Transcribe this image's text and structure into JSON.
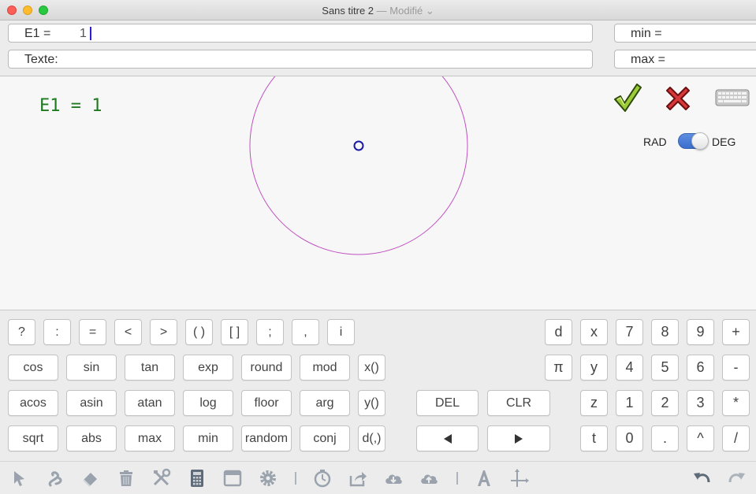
{
  "window": {
    "title": "Sans titre 2",
    "title_separator": " — ",
    "title_status": "Modifié"
  },
  "form": {
    "e1_label": "E1 =",
    "e1_value": "1",
    "texte_label": "Texte:",
    "min_label": "min =",
    "max_label": "max ="
  },
  "canvas": {
    "expression": "E1 = 1",
    "rad_label": "RAD",
    "deg_label": "DEG",
    "angle_mode": "DEG",
    "colors": {
      "circle": "#c050c0",
      "point": "#1a1aa8",
      "expression": "#1f7a1f"
    }
  },
  "keypad": {
    "row1_symbols": [
      "?",
      ":",
      "=",
      "<",
      ">",
      "( )",
      "[ ]",
      ";",
      ",",
      "i"
    ],
    "functions_row2": [
      "cos",
      "sin",
      "tan",
      "exp",
      "round",
      "mod",
      "x()"
    ],
    "functions_row3": [
      "acos",
      "asin",
      "atan",
      "log",
      "floor",
      "arg",
      "y()"
    ],
    "functions_row4": [
      "sqrt",
      "abs",
      "max",
      "min",
      "random",
      "conj",
      "d(,)"
    ],
    "del_label": "DEL",
    "clr_label": "CLR",
    "num_row1": [
      "d",
      "x",
      "7",
      "8",
      "9",
      "+"
    ],
    "num_row2": [
      "π",
      "y",
      "4",
      "5",
      "6",
      "-"
    ],
    "num_row3": [
      "z",
      "1",
      "2",
      "3",
      "*"
    ],
    "num_row4": [
      "t",
      "0",
      ".",
      "^",
      "/"
    ]
  },
  "toolbar": {
    "icons": [
      "pointer-icon",
      "curve-icon",
      "eraser-icon",
      "trash-icon",
      "tools-icon",
      "calculator-icon",
      "window-icon",
      "gear-icon",
      "timer-icon",
      "share-icon",
      "cloud-download-icon",
      "cloud-upload-icon",
      "text-icon",
      "axes-icon",
      "undo-icon",
      "redo-icon"
    ]
  }
}
